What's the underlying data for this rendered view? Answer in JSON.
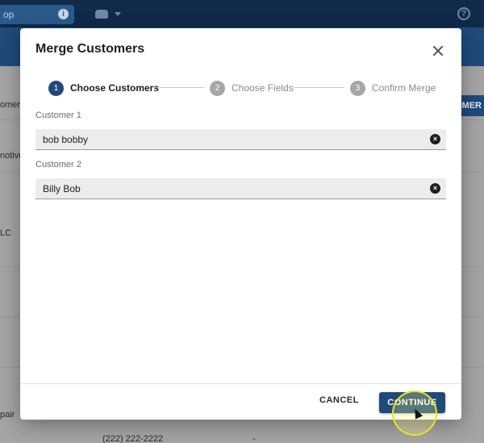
{
  "background": {
    "search_text": "op",
    "info_icon": "info-icon",
    "help_icon": "help-icon",
    "customer_button_text": "OMER",
    "column_header_text": "omer",
    "row_texts": [
      "notive",
      "LC",
      "pair"
    ],
    "phone_text": "(222) 222-2222",
    "dash_text": "-"
  },
  "modal": {
    "title": "Merge Customers",
    "steps": [
      {
        "number": "1",
        "label": "Choose Customers"
      },
      {
        "number": "2",
        "label": "Choose Fields"
      },
      {
        "number": "3",
        "label": "Confirm Merge"
      }
    ],
    "customer1": {
      "label": "Customer 1",
      "value": "bob bobby"
    },
    "customer2": {
      "label": "Customer 2",
      "value": "Billy Bob"
    },
    "cancel_label": "CANCEL",
    "continue_label": "CONTINUE"
  },
  "colors": {
    "primary": "#1f4a7a",
    "topbar": "#102a4a",
    "highlight": "#e6e61e"
  }
}
